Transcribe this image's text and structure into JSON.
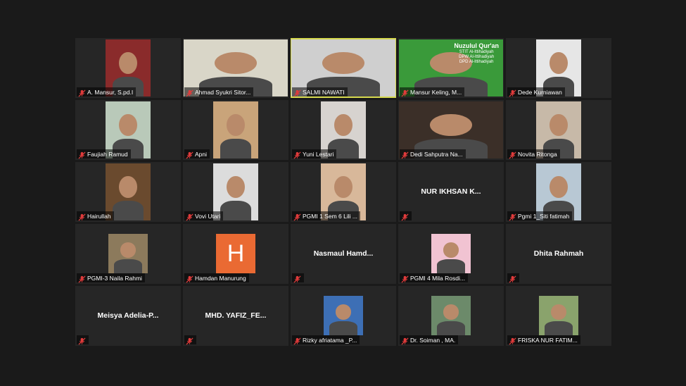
{
  "participants": [
    {
      "name": "A. Mansur, S.pd.I",
      "type": "video",
      "bg": "#8a2b2b"
    },
    {
      "name": "Ahmad Syukri Sitor...",
      "type": "video-wide",
      "bg": "#d9d6c8"
    },
    {
      "name": "SALMI NAWATI",
      "type": "video-wide",
      "bg": "#cfcfcf",
      "active": true
    },
    {
      "name": "Mansur Keling, M...",
      "type": "video-wide",
      "bg": "#3a9a3a",
      "banner": {
        "title": "Nuzulul Qur'an",
        "line1": "STIT Al-Ittihadiyah",
        "line2": "DPW Al-Ittihadiyah",
        "line3": "DPD Al-Ittihadiyah"
      }
    },
    {
      "name": "Dede Kurniawan",
      "type": "video",
      "bg": "#e6e6e6"
    },
    {
      "name": "Faujiah Ramud",
      "type": "video",
      "bg": "#b9c9b9"
    },
    {
      "name": "Apni",
      "type": "video",
      "bg": "#c9a47a"
    },
    {
      "name": "Yuni Lestari",
      "type": "video",
      "bg": "#d7d3cf"
    },
    {
      "name": "Dedi Sahputra Na...",
      "type": "video-wide",
      "bg": "#3b2f28"
    },
    {
      "name": "Novita Ritonga",
      "type": "video",
      "bg": "#c7b9a8"
    },
    {
      "name": "Hairullah",
      "type": "video",
      "bg": "#6a4a2e"
    },
    {
      "name": "Vovi Utari",
      "type": "video",
      "bg": "#dcdcdc"
    },
    {
      "name": "PGMI 1 Sem 6 Lili ...",
      "type": "video",
      "bg": "#d8b89a"
    },
    {
      "name": "",
      "type": "name",
      "display": "NUR IKHSAN K..."
    },
    {
      "name": "Pgmi 1_Siti fatimah",
      "type": "video",
      "bg": "#b8c8d4"
    },
    {
      "name": "PGMI-3 Naila Rahmi",
      "type": "photo",
      "bg": "#8c7a5c"
    },
    {
      "name": "Hamdan Manurung",
      "type": "letter",
      "letter": "H"
    },
    {
      "name": "",
      "type": "name",
      "display": "Nasmaul  Hamd..."
    },
    {
      "name": "PGMI 4 Mila Rosdi...",
      "type": "photo",
      "bg": "#f1c3d2"
    },
    {
      "name": "",
      "type": "name",
      "display": "Dhita Rahmah"
    },
    {
      "name": "",
      "type": "name",
      "display": "Meisya  Adelia-P..."
    },
    {
      "name": "",
      "type": "name",
      "display": "MHD.  YAFIZ_FE..."
    },
    {
      "name": "Rizky afriatama _P...",
      "type": "photo",
      "bg": "#3d6fb5"
    },
    {
      "name": "Dr. Soiman , MA.",
      "type": "photo",
      "bg": "#6c8a6a"
    },
    {
      "name": "FRISKA NUR FATIM...",
      "type": "photo",
      "bg": "#8aa36c"
    }
  ]
}
